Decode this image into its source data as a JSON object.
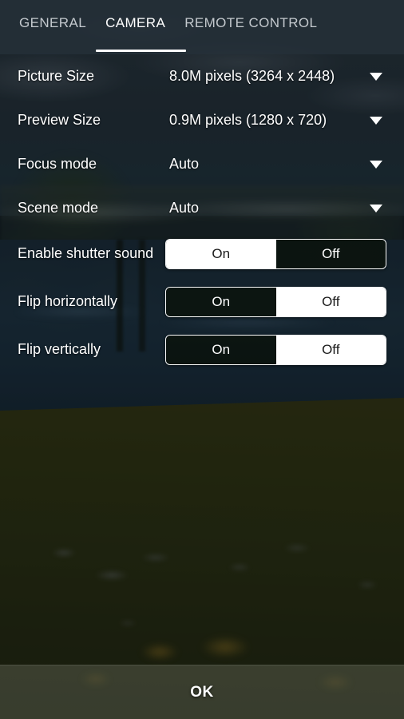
{
  "tabs": [
    {
      "label": "GENERAL",
      "active": false
    },
    {
      "label": "CAMERA",
      "active": true
    },
    {
      "label": "REMOTE CONTROL",
      "active": false
    }
  ],
  "settings": {
    "picture_size": {
      "label": "Picture Size",
      "value": "8.0M pixels (3264  x 2448)",
      "icon": "chevron-down-icon"
    },
    "preview_size": {
      "label": "Preview Size",
      "value": "0.9M pixels (1280  x 720)",
      "icon": "chevron-down-icon"
    },
    "focus_mode": {
      "label": "Focus mode",
      "value": "Auto",
      "icon": "chevron-down-icon"
    },
    "scene_mode": {
      "label": "Scene mode",
      "value": "Auto",
      "icon": "chevron-down-icon"
    },
    "shutter_sound": {
      "label": "Enable shutter sound",
      "on_label": "On",
      "off_label": "Off",
      "selected": "On"
    },
    "flip_horizontal": {
      "label": "Flip horizontally",
      "on_label": "On",
      "off_label": "Off",
      "selected": "Off"
    },
    "flip_vertical": {
      "label": "Flip vertically",
      "on_label": "On",
      "off_label": "Off",
      "selected": "Off"
    }
  },
  "footer": {
    "ok_label": "OK"
  },
  "colors": {
    "accent": "#ffffff",
    "tab_inactive": "#c4c9ce",
    "tab_bar_bg": "#263139",
    "segment_selected_bg": "#ffffff",
    "segment_unselected_bg": "#0a120a",
    "footer_bg": "#b0b4a4"
  }
}
